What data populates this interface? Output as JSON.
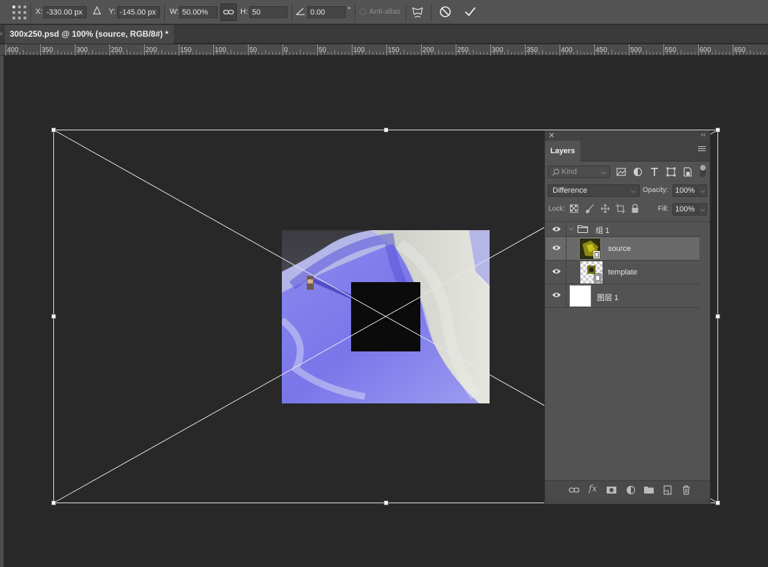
{
  "options_bar": {
    "x_label": "X:",
    "x_value": "-330.00 px",
    "y_label": "Y:",
    "y_value": "-145.00 px",
    "w_label": "W:",
    "w_value": "50.00%",
    "h_label": "H:",
    "h_value": "50",
    "angle_value": "0.00",
    "degree_symbol": "°",
    "antialias_label": "Anti-alias"
  },
  "document_tab": {
    "title": "300x250.psd @ 100% (source, RGB/8#) *"
  },
  "ruler": {
    "labels": [
      "400",
      "350",
      "300",
      "250",
      "200",
      "150",
      "100",
      "50",
      "0",
      "50",
      "100",
      "150",
      "200",
      "250",
      "300",
      "350",
      "400",
      "450",
      "500",
      "550",
      "600",
      "650"
    ]
  },
  "layers_panel": {
    "tab_label": "Layers",
    "filter_kind": "Kind",
    "blend_mode": "Difference",
    "opacity_label": "Opacity:",
    "opacity_value": "100%",
    "lock_label": "Lock:",
    "fill_label": "Fill:",
    "fill_value": "100%",
    "layers": [
      {
        "name": "组 1",
        "type": "group",
        "visible": true,
        "expanded": true
      },
      {
        "name": "source",
        "type": "smart-object",
        "visible": true,
        "selected": true
      },
      {
        "name": "template",
        "type": "smart-object",
        "visible": true
      },
      {
        "name": "图层 1",
        "type": "pixel",
        "visible": true
      }
    ]
  },
  "colors": {
    "canvas_bg": "#282828",
    "panel_bg": "#535353",
    "selected_row": "#696969"
  }
}
